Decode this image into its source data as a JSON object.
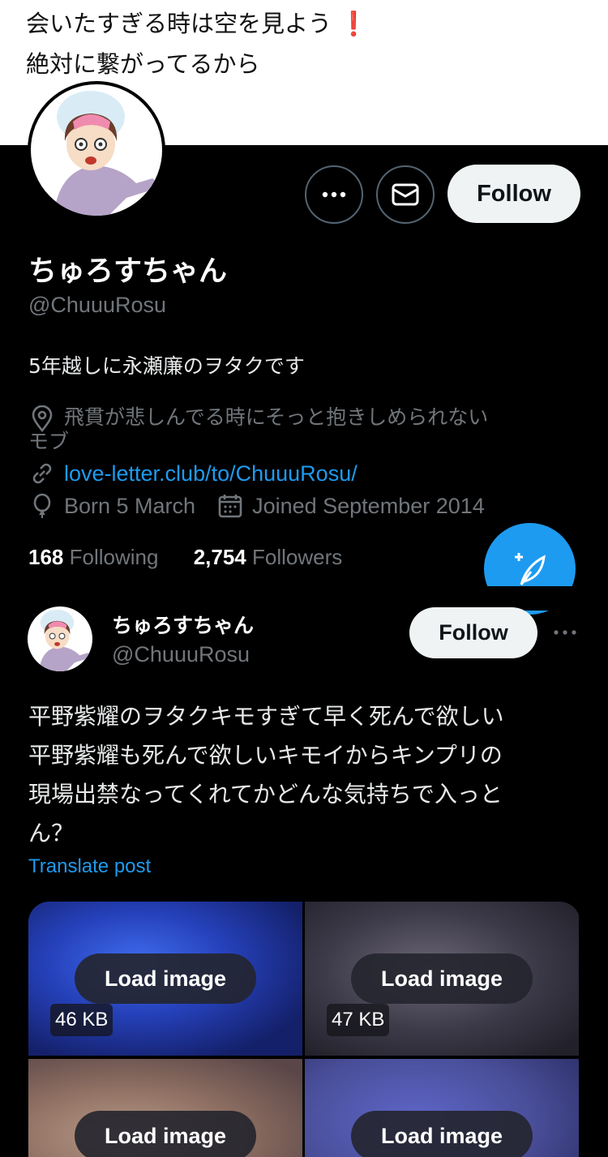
{
  "banner": {
    "line1": "会いたすぎる時は空を見よう",
    "line1_mark": "❗",
    "line2": "絶対に繋がってるから"
  },
  "profile": {
    "display_name": "ちゅろすちゃん",
    "handle": "@ChuuuRosu",
    "bio": "5年越しに永瀬廉のヲタクです",
    "location_line1": "飛貫が悲しんでる時にそっと抱きしめられない",
    "location_line2": "モブ",
    "link": "love-letter.club/to/ChuuuRosu/",
    "born": "Born 5 March",
    "joined": "Joined September 2014",
    "following_count": "168",
    "following_label": "Following",
    "followers_count": "2,754",
    "followers_label": "Followers",
    "follow_label": "Follow",
    "more_icon": "more-horizontal-icon",
    "message_icon": "envelope-icon"
  },
  "compose": {
    "icon": "compose-feather-plus-icon",
    "color": "#1d9bf0"
  },
  "tweet": {
    "display_name": "ちゅろすちゃん",
    "handle": "@ChuuuRosu",
    "follow_label": "Follow",
    "text_lines": [
      "平野紫耀のヲタクキモすぎて早く死んで欲しい",
      "平野紫耀も死んで欲しいキモイからキンプリの",
      "現場出禁なってくれてかどんな気持ちで入っと",
      "ん？"
    ],
    "translate_label": "Translate post",
    "images": [
      {
        "load_label": "Load image",
        "size": "46 KB"
      },
      {
        "load_label": "Load image",
        "size": "47 KB"
      },
      {
        "load_label": "Load image",
        "size": ""
      },
      {
        "load_label": "Load image",
        "size": ""
      }
    ]
  },
  "colors": {
    "accent": "#1d9bf0",
    "background": "#000000",
    "muted": "#71767b"
  }
}
